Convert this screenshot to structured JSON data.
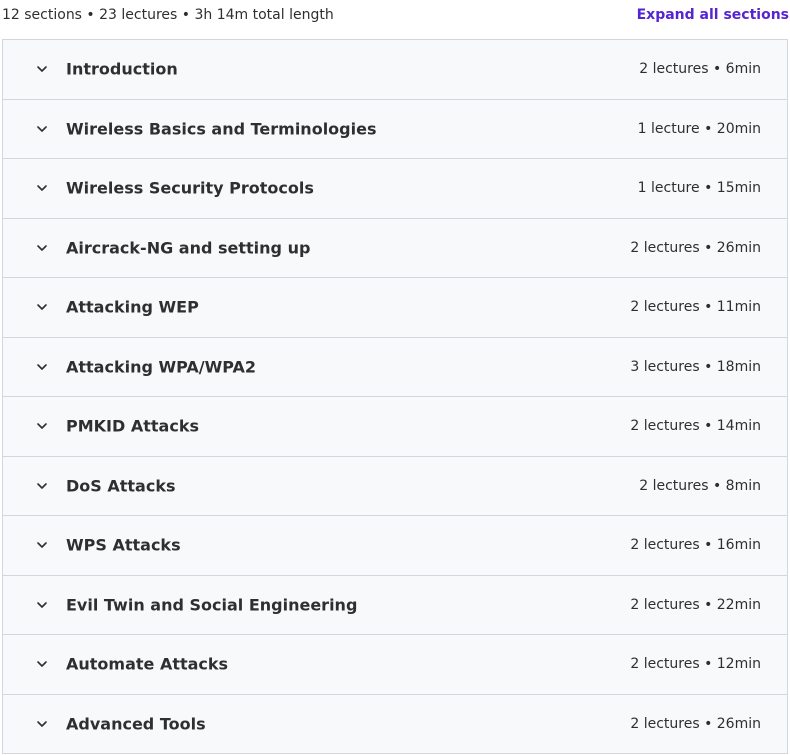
{
  "summary": {
    "text": "12 sections • 23 lectures • 3h 14m total length",
    "expand_all_label": "Expand all sections"
  },
  "sections": [
    {
      "title": "Introduction",
      "meta": "2 lectures • 6min"
    },
    {
      "title": "Wireless Basics and Terminologies",
      "meta": "1 lecture • 20min"
    },
    {
      "title": "Wireless Security Protocols",
      "meta": "1 lecture • 15min"
    },
    {
      "title": "Aircrack-NG and setting up",
      "meta": "2 lectures • 26min"
    },
    {
      "title": "Attacking WEP",
      "meta": "2 lectures • 11min"
    },
    {
      "title": "Attacking WPA/WPA2",
      "meta": "3 lectures • 18min"
    },
    {
      "title": "PMKID Attacks",
      "meta": "2 lectures • 14min"
    },
    {
      "title": "DoS Attacks",
      "meta": "2 lectures • 8min"
    },
    {
      "title": "WPS Attacks",
      "meta": "2 lectures • 16min"
    },
    {
      "title": "Evil Twin and Social Engineering",
      "meta": "2 lectures • 22min"
    },
    {
      "title": "Automate Attacks",
      "meta": "2 lectures • 12min"
    },
    {
      "title": "Advanced Tools",
      "meta": "2 lectures • 26min"
    }
  ],
  "icons": {
    "section_toggle": "chevron-down-icon"
  },
  "colors": {
    "accent": "#5624d0",
    "row_background": "#f7f9fa",
    "border": "#d1d7dc",
    "text": "#2d2f31"
  }
}
